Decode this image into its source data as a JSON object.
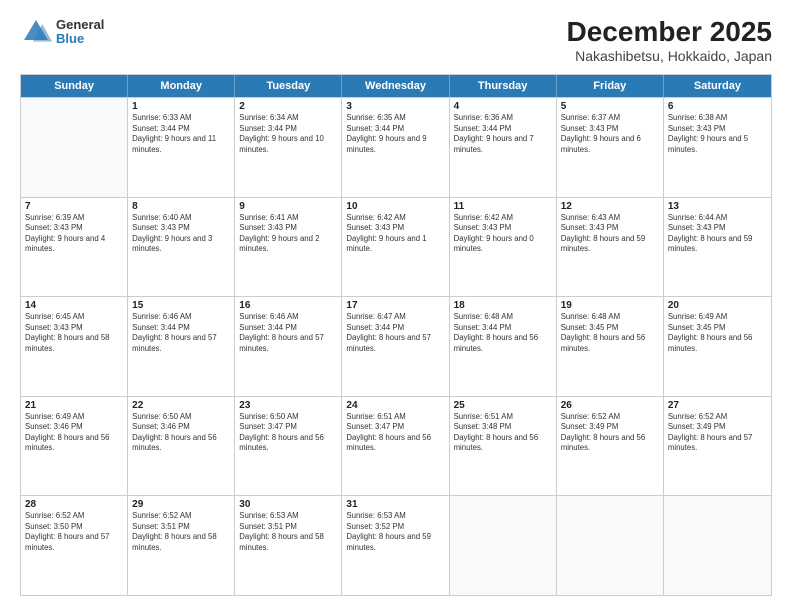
{
  "logo": {
    "general": "General",
    "blue": "Blue"
  },
  "title": "December 2025",
  "subtitle": "Nakashibetsu, Hokkaido, Japan",
  "header_days": [
    "Sunday",
    "Monday",
    "Tuesday",
    "Wednesday",
    "Thursday",
    "Friday",
    "Saturday"
  ],
  "weeks": [
    [
      {
        "day": "",
        "sunrise": "",
        "sunset": "",
        "daylight": ""
      },
      {
        "day": "1",
        "sunrise": "Sunrise: 6:33 AM",
        "sunset": "Sunset: 3:44 PM",
        "daylight": "Daylight: 9 hours and 11 minutes."
      },
      {
        "day": "2",
        "sunrise": "Sunrise: 6:34 AM",
        "sunset": "Sunset: 3:44 PM",
        "daylight": "Daylight: 9 hours and 10 minutes."
      },
      {
        "day": "3",
        "sunrise": "Sunrise: 6:35 AM",
        "sunset": "Sunset: 3:44 PM",
        "daylight": "Daylight: 9 hours and 9 minutes."
      },
      {
        "day": "4",
        "sunrise": "Sunrise: 6:36 AM",
        "sunset": "Sunset: 3:44 PM",
        "daylight": "Daylight: 9 hours and 7 minutes."
      },
      {
        "day": "5",
        "sunrise": "Sunrise: 6:37 AM",
        "sunset": "Sunset: 3:43 PM",
        "daylight": "Daylight: 9 hours and 6 minutes."
      },
      {
        "day": "6",
        "sunrise": "Sunrise: 6:38 AM",
        "sunset": "Sunset: 3:43 PM",
        "daylight": "Daylight: 9 hours and 5 minutes."
      }
    ],
    [
      {
        "day": "7",
        "sunrise": "Sunrise: 6:39 AM",
        "sunset": "Sunset: 3:43 PM",
        "daylight": "Daylight: 9 hours and 4 minutes."
      },
      {
        "day": "8",
        "sunrise": "Sunrise: 6:40 AM",
        "sunset": "Sunset: 3:43 PM",
        "daylight": "Daylight: 9 hours and 3 minutes."
      },
      {
        "day": "9",
        "sunrise": "Sunrise: 6:41 AM",
        "sunset": "Sunset: 3:43 PM",
        "daylight": "Daylight: 9 hours and 2 minutes."
      },
      {
        "day": "10",
        "sunrise": "Sunrise: 6:42 AM",
        "sunset": "Sunset: 3:43 PM",
        "daylight": "Daylight: 9 hours and 1 minute."
      },
      {
        "day": "11",
        "sunrise": "Sunrise: 6:42 AM",
        "sunset": "Sunset: 3:43 PM",
        "daylight": "Daylight: 9 hours and 0 minutes."
      },
      {
        "day": "12",
        "sunrise": "Sunrise: 6:43 AM",
        "sunset": "Sunset: 3:43 PM",
        "daylight": "Daylight: 8 hours and 59 minutes."
      },
      {
        "day": "13",
        "sunrise": "Sunrise: 6:44 AM",
        "sunset": "Sunset: 3:43 PM",
        "daylight": "Daylight: 8 hours and 59 minutes."
      }
    ],
    [
      {
        "day": "14",
        "sunrise": "Sunrise: 6:45 AM",
        "sunset": "Sunset: 3:43 PM",
        "daylight": "Daylight: 8 hours and 58 minutes."
      },
      {
        "day": "15",
        "sunrise": "Sunrise: 6:46 AM",
        "sunset": "Sunset: 3:44 PM",
        "daylight": "Daylight: 8 hours and 57 minutes."
      },
      {
        "day": "16",
        "sunrise": "Sunrise: 6:46 AM",
        "sunset": "Sunset: 3:44 PM",
        "daylight": "Daylight: 8 hours and 57 minutes."
      },
      {
        "day": "17",
        "sunrise": "Sunrise: 6:47 AM",
        "sunset": "Sunset: 3:44 PM",
        "daylight": "Daylight: 8 hours and 57 minutes."
      },
      {
        "day": "18",
        "sunrise": "Sunrise: 6:48 AM",
        "sunset": "Sunset: 3:44 PM",
        "daylight": "Daylight: 8 hours and 56 minutes."
      },
      {
        "day": "19",
        "sunrise": "Sunrise: 6:48 AM",
        "sunset": "Sunset: 3:45 PM",
        "daylight": "Daylight: 8 hours and 56 minutes."
      },
      {
        "day": "20",
        "sunrise": "Sunrise: 6:49 AM",
        "sunset": "Sunset: 3:45 PM",
        "daylight": "Daylight: 8 hours and 56 minutes."
      }
    ],
    [
      {
        "day": "21",
        "sunrise": "Sunrise: 6:49 AM",
        "sunset": "Sunset: 3:46 PM",
        "daylight": "Daylight: 8 hours and 56 minutes."
      },
      {
        "day": "22",
        "sunrise": "Sunrise: 6:50 AM",
        "sunset": "Sunset: 3:46 PM",
        "daylight": "Daylight: 8 hours and 56 minutes."
      },
      {
        "day": "23",
        "sunrise": "Sunrise: 6:50 AM",
        "sunset": "Sunset: 3:47 PM",
        "daylight": "Daylight: 8 hours and 56 minutes."
      },
      {
        "day": "24",
        "sunrise": "Sunrise: 6:51 AM",
        "sunset": "Sunset: 3:47 PM",
        "daylight": "Daylight: 8 hours and 56 minutes."
      },
      {
        "day": "25",
        "sunrise": "Sunrise: 6:51 AM",
        "sunset": "Sunset: 3:48 PM",
        "daylight": "Daylight: 8 hours and 56 minutes."
      },
      {
        "day": "26",
        "sunrise": "Sunrise: 6:52 AM",
        "sunset": "Sunset: 3:49 PM",
        "daylight": "Daylight: 8 hours and 56 minutes."
      },
      {
        "day": "27",
        "sunrise": "Sunrise: 6:52 AM",
        "sunset": "Sunset: 3:49 PM",
        "daylight": "Daylight: 8 hours and 57 minutes."
      }
    ],
    [
      {
        "day": "28",
        "sunrise": "Sunrise: 6:52 AM",
        "sunset": "Sunset: 3:50 PM",
        "daylight": "Daylight: 8 hours and 57 minutes."
      },
      {
        "day": "29",
        "sunrise": "Sunrise: 6:52 AM",
        "sunset": "Sunset: 3:51 PM",
        "daylight": "Daylight: 8 hours and 58 minutes."
      },
      {
        "day": "30",
        "sunrise": "Sunrise: 6:53 AM",
        "sunset": "Sunset: 3:51 PM",
        "daylight": "Daylight: 8 hours and 58 minutes."
      },
      {
        "day": "31",
        "sunrise": "Sunrise: 6:53 AM",
        "sunset": "Sunset: 3:52 PM",
        "daylight": "Daylight: 8 hours and 59 minutes."
      },
      {
        "day": "",
        "sunrise": "",
        "sunset": "",
        "daylight": ""
      },
      {
        "day": "",
        "sunrise": "",
        "sunset": "",
        "daylight": ""
      },
      {
        "day": "",
        "sunrise": "",
        "sunset": "",
        "daylight": ""
      }
    ]
  ]
}
